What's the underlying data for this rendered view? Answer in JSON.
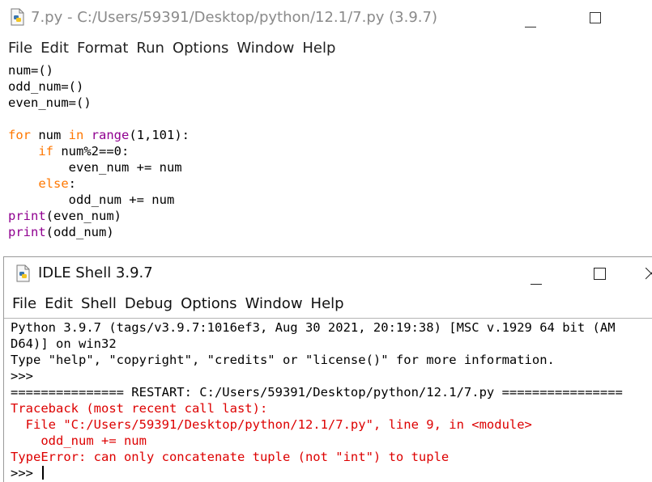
{
  "editor": {
    "title": "7.py - C:/Users/59391/Desktop/python/12.1/7.py (3.9.7)",
    "menu": [
      "File",
      "Edit",
      "Format",
      "Run",
      "Options",
      "Window",
      "Help"
    ],
    "code_lines": [
      [
        [
          "pl",
          "num=()"
        ]
      ],
      [
        [
          "pl",
          "odd_num=()"
        ]
      ],
      [
        [
          "pl",
          "even_num=()"
        ]
      ],
      [],
      [
        [
          "kw",
          "for"
        ],
        [
          "pl",
          " num "
        ],
        [
          "kw",
          "in"
        ],
        [
          "pl",
          " "
        ],
        [
          "bi",
          "range"
        ],
        [
          "pl",
          "(1,101):"
        ]
      ],
      [
        [
          "pl",
          "    "
        ],
        [
          "kw",
          "if"
        ],
        [
          "pl",
          " num%2==0:"
        ]
      ],
      [
        [
          "pl",
          "        even_num += num"
        ]
      ],
      [
        [
          "pl",
          "    "
        ],
        [
          "kw",
          "else"
        ],
        [
          "pl",
          ":"
        ]
      ],
      [
        [
          "pl",
          "        odd_num += num"
        ]
      ],
      [
        [
          "bi",
          "print"
        ],
        [
          "pl",
          "(even_num)"
        ]
      ],
      [
        [
          "bi",
          "print"
        ],
        [
          "pl",
          "(odd_num)"
        ]
      ]
    ]
  },
  "shell": {
    "title": "IDLE Shell 3.9.7",
    "menu": [
      "File",
      "Edit",
      "Shell",
      "Debug",
      "Options",
      "Window",
      "Help"
    ],
    "output_lines": [
      [
        [
          "pl",
          "Python 3.9.7 (tags/v3.9.7:1016ef3, Aug 30 2021, 20:19:38) [MSC v.1929 64 bit (AM"
        ]
      ],
      [
        [
          "pl",
          "D64)] on win32"
        ]
      ],
      [
        [
          "pl",
          "Type \"help\", \"copyright\", \"credits\" or \"license()\" for more information."
        ]
      ],
      [
        [
          "prompt",
          ">>>"
        ]
      ],
      [
        [
          "pl",
          "=============== RESTART: C:/Users/59391/Desktop/python/12.1/7.py ================"
        ]
      ],
      [
        [
          "err",
          "Traceback (most recent call last):"
        ]
      ],
      [
        [
          "err",
          "  File \"C:/Users/59391/Desktop/python/12.1/7.py\", line 9, in <module>"
        ]
      ],
      [
        [
          "err",
          "    odd_num += num"
        ]
      ],
      [
        [
          "err",
          "TypeError: can only concatenate tuple (not \"int\") to tuple"
        ]
      ],
      [
        [
          "prompt",
          ">>> "
        ]
      ]
    ]
  },
  "icons": {
    "editor_file_icon": "python-file-icon",
    "shell_icon": "python-file-icon",
    "minimize": "minimize-icon",
    "maximize": "maximize-icon",
    "close": "close-icon"
  }
}
